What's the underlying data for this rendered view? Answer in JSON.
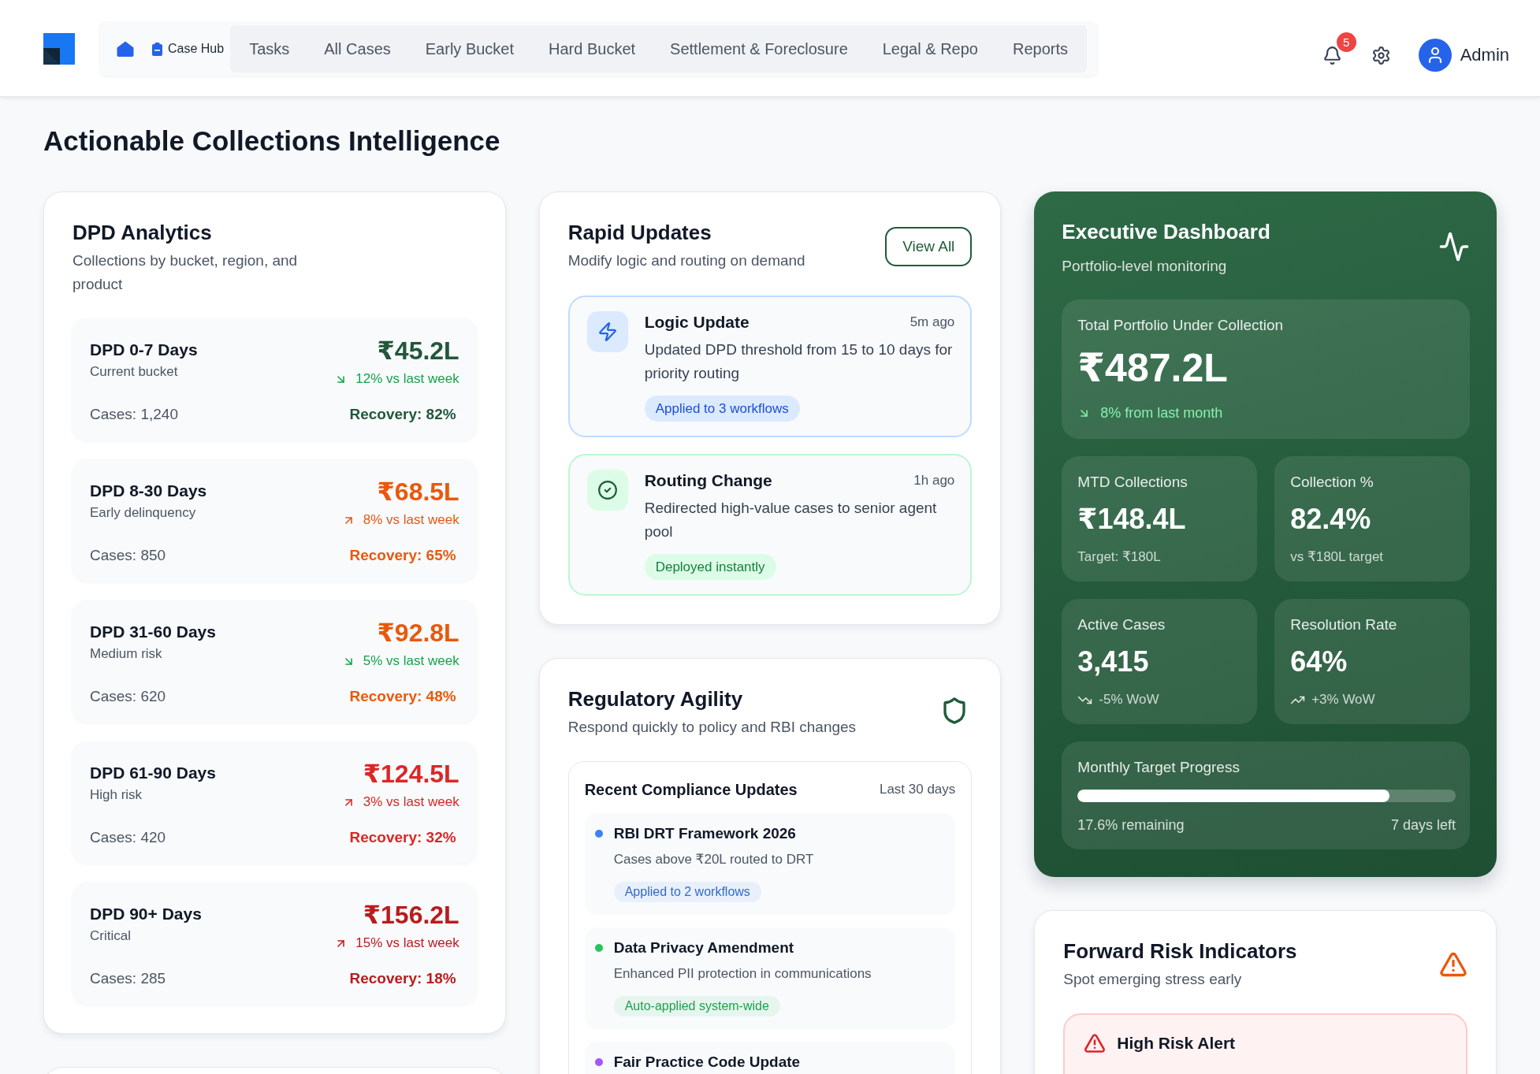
{
  "header": {
    "nav": {
      "section": "Case Hub",
      "links": [
        "Tasks",
        "All Cases",
        "Early Bucket",
        "Hard Bucket",
        "Settlement & Foreclosure",
        "Legal & Repo",
        "Reports"
      ]
    },
    "notifications": "5",
    "user": "Admin"
  },
  "page_title": "Actionable Collections Intelligence",
  "dpd_analytics": {
    "title": "DPD Analytics",
    "subtitle": "Collections by bucket, region, and product",
    "buckets": [
      {
        "kind": "falling",
        "name": "DPD 0-7 Days",
        "description": "Current bucket",
        "amount": "₹45.2L",
        "change": "12% vs last week",
        "cases": "Cases: 1,240",
        "recovery": "Recovery: 82%",
        "color": "#22573a"
      },
      {
        "kind": "rising",
        "name": "DPD 8-30 Days",
        "description": "Early delinquency",
        "amount": "₹68.5L",
        "change": "8% vs last week",
        "cases": "Cases: 850",
        "recovery": "Recovery: 65%",
        "color": "#ea580c"
      },
      {
        "kind": "falling",
        "name": "DPD 31-60 Days",
        "description": "Medium risk",
        "amount": "₹92.8L",
        "change": "5% vs last week",
        "cases": "Cases: 620",
        "recovery": "Recovery: 48%",
        "color": "#ea580c"
      },
      {
        "kind": "rising",
        "name": "DPD 61-90 Days",
        "description": "High risk",
        "amount": "₹124.5L",
        "change": "3% vs last week",
        "cases": "Cases: 420",
        "recovery": "Recovery: 32%",
        "color": "#dc2626"
      },
      {
        "kind": "rising",
        "name": "DPD 90+ Days",
        "description": "Critical",
        "amount": "₹156.2L",
        "change": "15% vs last week",
        "cases": "Cases: 285",
        "recovery": "Recovery: 18%",
        "color": "#b91c1c"
      }
    ]
  },
  "rapid_updates": {
    "title": "Rapid Updates",
    "subtitle": "Modify logic and routing on demand",
    "action": "View All",
    "updates": [
      {
        "kind": "logic",
        "title": "Logic Update",
        "time": "5m ago",
        "description": "Updated DPD threshold from 15 to 10 days for priority routing",
        "tag": "Applied to 3 workflows"
      },
      {
        "kind": "routing",
        "title": "Routing Change",
        "time": "1h ago",
        "description": "Redirected high-value cases to senior agent pool",
        "tag": "Deployed instantly"
      }
    ]
  },
  "regulatory_agility": {
    "title": "Regulatory Agility",
    "subtitle": "Respond quickly to policy and RBI changes",
    "compliance": {
      "title": "Recent Compliance Updates",
      "period": "Last 30 days",
      "items": [
        {
          "title": "RBI DRT Framework 2026",
          "description": "Cases above ₹20L routed to DRT",
          "tag": "Applied to 2 workflows",
          "color": "#3b82f6"
        },
        {
          "title": "Data Privacy Amendment",
          "description": "Enhanced PII protection in communications",
          "tag": "Auto-applied system-wide",
          "color": "#22c55e"
        },
        {
          "title": "Fair Practice Code Update",
          "color": "#a855f7"
        }
      ]
    }
  },
  "executive_dashboard": {
    "title": "Executive Dashboard",
    "subtitle": "Portfolio-level monitoring",
    "portfolio": {
      "kind": "falling",
      "label": "Total Portfolio Under Collection",
      "value": "₹487.2L",
      "change": "8% from last month"
    },
    "metrics": [
      {
        "kind": "plain",
        "label": "MTD Collections",
        "value": "₹148.4L",
        "note": "Target: ₹180L"
      },
      {
        "kind": "plain",
        "label": "Collection %",
        "value": "82.4%",
        "note": "vs ₹180L target"
      },
      {
        "kind": "falling",
        "label": "Active Cases",
        "value": "3,415",
        "note": "-5% WoW"
      },
      {
        "kind": "rising",
        "label": "Resolution Rate",
        "value": "64%",
        "note": "+3% WoW"
      }
    ],
    "progress": {
      "label": "Monthly Target Progress",
      "level": 0.824,
      "remaining": "17.6% remaining",
      "time_left": "7 days left"
    }
  },
  "forward_risk": {
    "title": "Forward Risk Indicators",
    "subtitle": "Spot emerging stress early",
    "alerts": [
      {
        "kind": "high",
        "title": "High Risk Alert"
      }
    ]
  }
}
